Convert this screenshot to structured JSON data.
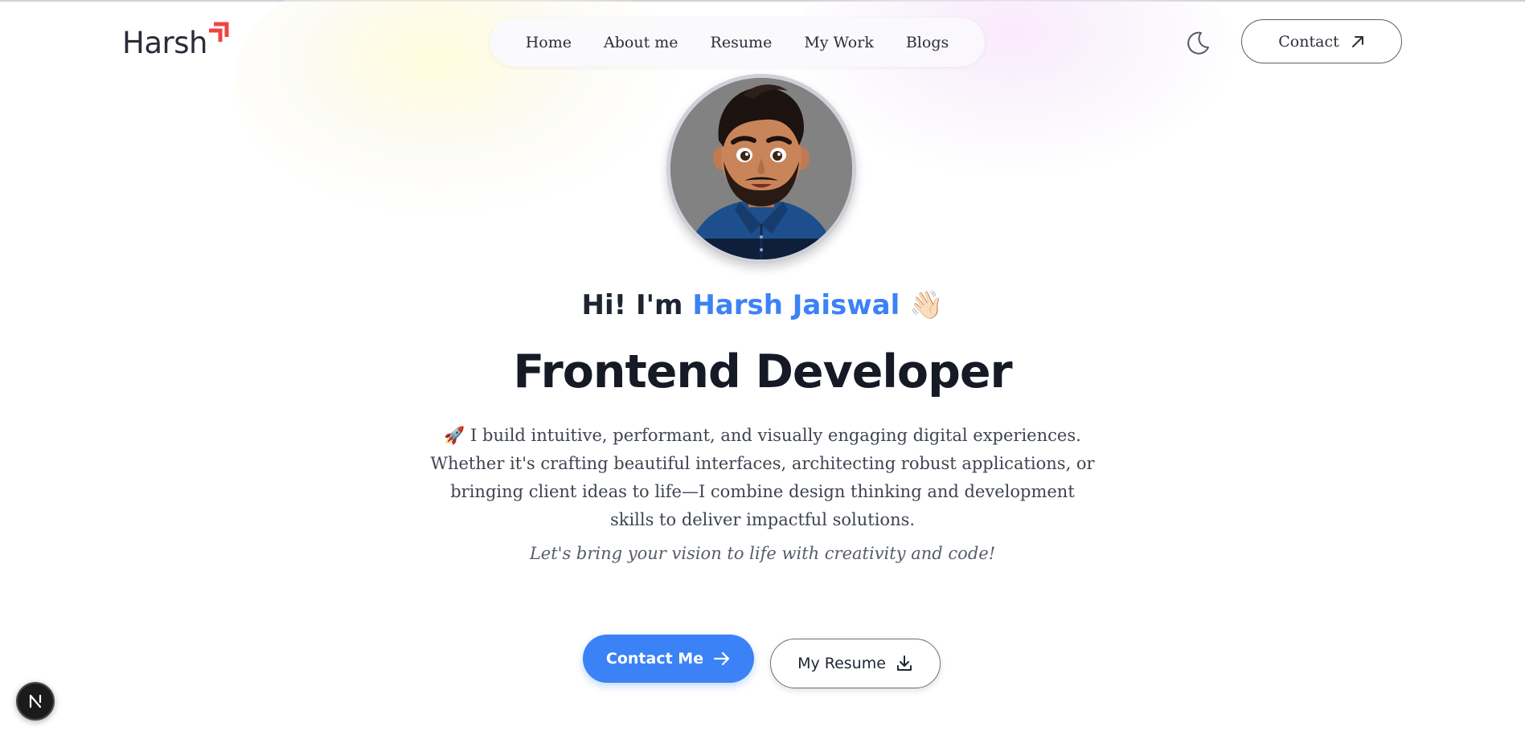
{
  "brand": {
    "logo_text": "Harsh",
    "accent_color": "#ef4444"
  },
  "nav": {
    "items": [
      {
        "label": "Home"
      },
      {
        "label": "About me"
      },
      {
        "label": "Resume"
      },
      {
        "label": "My Work"
      },
      {
        "label": "Blogs"
      }
    ]
  },
  "header": {
    "theme_toggle_icon": "moon-icon",
    "contact_label": "Contact",
    "contact_icon": "arrow-up-right-icon"
  },
  "hero": {
    "avatar_icon": "cartoon-avatar",
    "greeting_prefix": "Hi! I'm",
    "greeting_name": "Harsh Jaiswal",
    "greeting_emoji": "👋🏻",
    "title": "Frontend Developer",
    "description_emoji": "🚀",
    "description": "I build intuitive, performant, and visually engaging digital experiences. Whether it's crafting beautiful interfaces, architecting robust applications, or bringing client ideas to life—I combine design thinking and development skills to deliver impactful solutions.",
    "tagline": "Let's bring your vision to life with creativity and code!",
    "primary_button": "Contact Me",
    "primary_button_icon": "arrow-right-icon",
    "secondary_button": "My Resume",
    "secondary_button_icon": "download-icon",
    "name_color": "#3b82f6",
    "button_color": "#3b82f6"
  },
  "dev_badge": {
    "label": "N",
    "icon": "nextjs-icon"
  }
}
